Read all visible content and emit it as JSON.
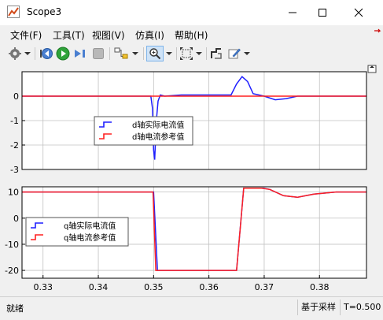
{
  "window": {
    "title": "Scope3"
  },
  "menu": [
    {
      "label": "文件(F)"
    },
    {
      "label": "工具(T)"
    },
    {
      "label": "视图(V)"
    },
    {
      "label": "仿真(I)"
    },
    {
      "label": "帮助(H)"
    }
  ],
  "toolbar": {
    "icons": [
      "gear-icon",
      "dropdown-arrow-icon",
      "step-back-icon",
      "run-icon",
      "step-forward-icon",
      "stop-icon",
      "highlight-block-icon",
      "dropdown-arrow-icon",
      "zoom-icon",
      "dropdown-arrow-icon",
      "autoscale-icon",
      "dropdown-arrow-icon",
      "cursor-measure-icon",
      "style-icon",
      "dropdown-arrow-icon"
    ]
  },
  "colors": {
    "actual": "#1f1fff",
    "reference": "#ff2020",
    "grid": "#c0c0c0",
    "plot_bg": "#ffffff"
  },
  "chart_data": [
    {
      "type": "line",
      "xlim": [
        0.3262,
        0.3885
      ],
      "ylim": [
        -3,
        1
      ],
      "yticks": [
        "0",
        "-1",
        "-2",
        "-3"
      ],
      "yticks_values": [
        0,
        -1,
        -2,
        -3
      ],
      "grid": true,
      "legend_location": "center-left",
      "series": [
        {
          "name": "d轴实际电流值",
          "x": [
            0.3262,
            0.3495,
            0.3498,
            0.35,
            0.3502,
            0.3505,
            0.3508,
            0.3512,
            0.352,
            0.355,
            0.36,
            0.364,
            0.365,
            0.366,
            0.367,
            0.368,
            0.37,
            0.372,
            0.374,
            0.376,
            0.38,
            0.3885
          ],
          "y": [
            0,
            0,
            -0.5,
            -2.2,
            -2.6,
            -1.0,
            -0.2,
            0.05,
            0.0,
            0.05,
            0.05,
            0.05,
            0.5,
            0.8,
            0.6,
            0.1,
            0.0,
            -0.15,
            -0.1,
            0.0,
            0.0,
            0.0
          ]
        },
        {
          "name": "d轴电流参考值",
          "x": [
            0.3262,
            0.3885
          ],
          "y": [
            0,
            0
          ]
        }
      ]
    },
    {
      "type": "line",
      "xlim": [
        0.3262,
        0.3885
      ],
      "ylim": [
        -23,
        12
      ],
      "yticks": [
        "10",
        "0",
        "-10",
        "-20"
      ],
      "yticks_values": [
        10,
        0,
        -10,
        -20
      ],
      "xticks": [
        "0.33",
        "0.34",
        "0.35",
        "0.36",
        "0.37",
        "0.38"
      ],
      "xticks_values": [
        0.33,
        0.34,
        0.35,
        0.36,
        0.37,
        0.38
      ],
      "grid": true,
      "legend_location": "bottom-left",
      "series": [
        {
          "name": "q轴实际电流值",
          "x": [
            0.3262,
            0.35,
            0.3507,
            0.365,
            0.3663,
            0.3698,
            0.371,
            0.3735,
            0.376,
            0.379,
            0.383,
            0.3885
          ],
          "y": [
            10,
            10,
            -20,
            -20,
            11.5,
            11.5,
            11,
            8.6,
            8.0,
            9.2,
            10.0,
            10.0
          ]
        },
        {
          "name": "q轴电流参考值",
          "x": [
            0.3262,
            0.3499,
            0.3504,
            0.365,
            0.3663,
            0.3695,
            0.371,
            0.3735,
            0.376,
            0.379,
            0.383,
            0.3885
          ],
          "y": [
            10,
            10,
            -20,
            -20,
            11.5,
            11.5,
            11,
            8.6,
            8.0,
            9.2,
            10.0,
            10.0
          ]
        }
      ]
    }
  ],
  "status": {
    "ready": "就绪",
    "sample_mode": "基于采样",
    "time": "T=0.500"
  }
}
